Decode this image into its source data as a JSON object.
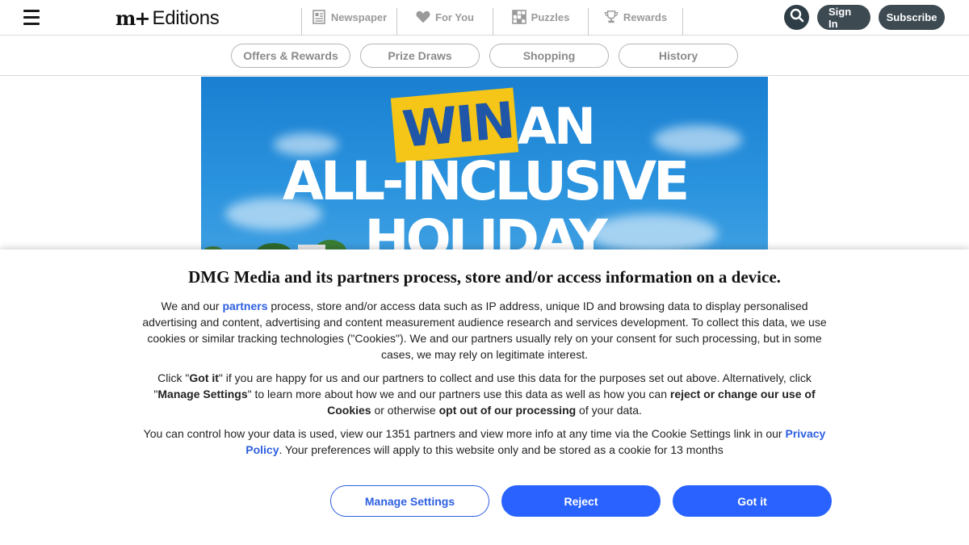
{
  "header": {
    "logo_mark": "m+",
    "logo_text": "Editions",
    "nav": [
      {
        "label": "Newspaper",
        "icon": "newspaper-icon"
      },
      {
        "label": "For You",
        "icon": "heart-icon"
      },
      {
        "label": "Puzzles",
        "icon": "puzzle-grid-icon"
      },
      {
        "label": "Rewards",
        "icon": "trophy-icon"
      }
    ],
    "sign_in_label": "Sign In",
    "subscribe_label": "Subscribe"
  },
  "subnav": {
    "tabs": [
      "Offers & Rewards",
      "Prize Draws",
      "Shopping",
      "History"
    ]
  },
  "banner": {
    "win": "WIN",
    "an": "AN",
    "line2": "ALL-INCLUSIVE",
    "line3": "HOLIDAY"
  },
  "consent": {
    "title": "DMG Media and its partners process, store and/or access information on a device.",
    "p1_a": "We and our ",
    "p1_link": "partners",
    "p1_b": " process, store and/or access data such as IP address, unique ID and browsing data to display personalised advertising and content, advertising and content measurement audience research and services development. To collect this data, we use cookies or similar tracking technologies (\"Cookies\"). We and our partners usually rely on your consent for such processing, but in some cases, we may rely on legitimate interest.",
    "p2_a": "Click \"",
    "p2_b1": "Got it",
    "p2_c": "\" if you are happy for us and our partners to collect and use this data for the purposes set out above. Alternatively, click \"",
    "p2_b2": "Manage Settings",
    "p2_d": "\" to learn more about how we and our partners use this data as well as how you can ",
    "p2_b3": "reject or change our use of Cookies",
    "p2_e": " or otherwise ",
    "p2_b4": "opt out of our processing",
    "p2_f": " of your data.",
    "p3_a": "You can control how your data is used, view our 1351 partners and view more info at any time via the Cookie Settings link in our ",
    "p3_link": "Privacy Policy",
    "p3_b": ". Your preferences will apply to this website only and be stored as a cookie for 13 months",
    "manage_label": "Manage Settings",
    "reject_label": "Reject",
    "gotit_label": "Got it"
  },
  "colors": {
    "accent": "#2962ff",
    "link": "#2d5fe0",
    "header_button": "#3d4a52",
    "banner_yellow": "#f5c518",
    "banner_blue": "#1f56a8"
  }
}
